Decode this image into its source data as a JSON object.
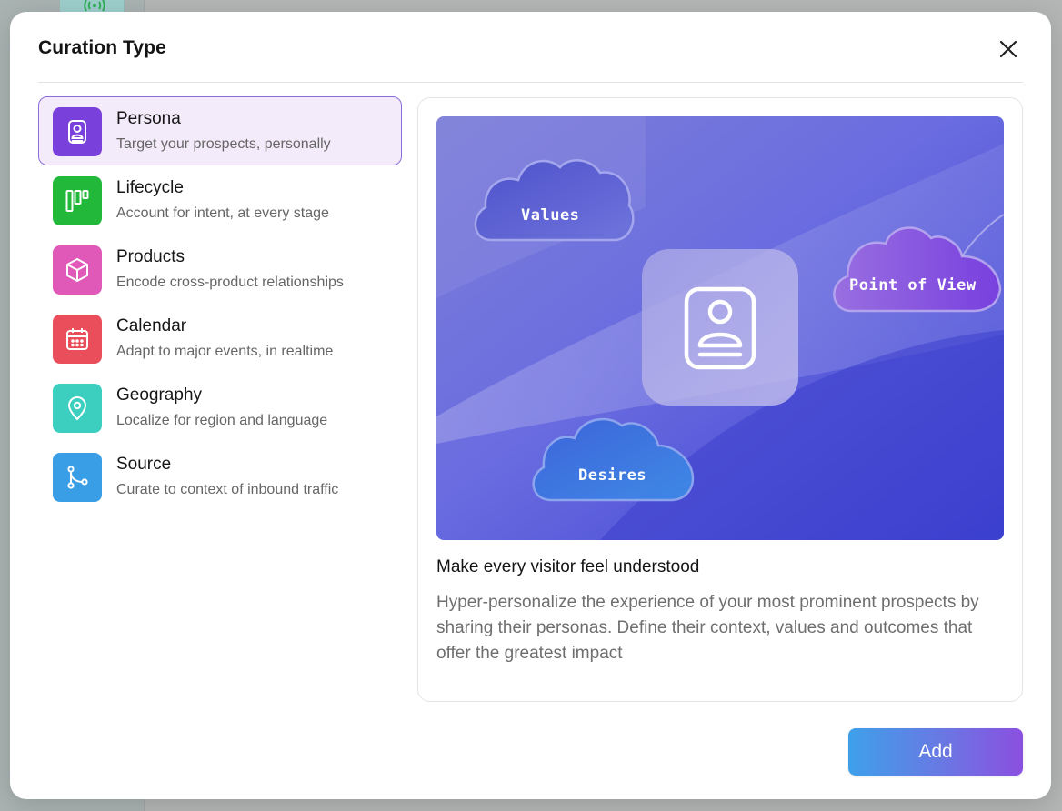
{
  "modal": {
    "title": "Curation Type",
    "close_icon": "close-icon"
  },
  "curation_types": [
    {
      "label": "Persona",
      "description": "Target your prospects, personally",
      "icon": "persona-icon",
      "color": "#7a40dc",
      "selected": true
    },
    {
      "label": "Lifecycle",
      "description": "Account for intent, at every stage",
      "icon": "lifecycle-icon",
      "color": "#22b83a",
      "selected": false
    },
    {
      "label": "Products",
      "description": "Encode cross-product relationships",
      "icon": "cube-icon",
      "color": "#e058b8",
      "selected": false
    },
    {
      "label": "Calendar",
      "description": "Adapt to major events, in realtime",
      "icon": "calendar-icon",
      "color": "#ea4e5a",
      "selected": false
    },
    {
      "label": "Geography",
      "description": "Localize for region and language",
      "icon": "location-pin-icon",
      "color": "#3ccfbf",
      "selected": false
    },
    {
      "label": "Source",
      "description": "Curate to context of inbound traffic",
      "icon": "branch-icon",
      "color": "#3a9ee6",
      "selected": false
    }
  ],
  "preview": {
    "hero": {
      "clouds": [
        "Values",
        "Point of View",
        "Desires"
      ],
      "center_icon": "persona-icon"
    },
    "heading": "Make every visitor feel understood",
    "body": "Hyper-personalize the experience of your most prominent prospects by sharing their personas. Define their context,  values and outcomes that offer the greatest impact"
  },
  "footer": {
    "add_label": "Add"
  },
  "colors": {
    "accent": "#8b6ddd",
    "selected_bg": "#f4ebfa",
    "button_gradient_start": "#3ea0ea",
    "button_gradient_end": "#8b4fe0"
  }
}
